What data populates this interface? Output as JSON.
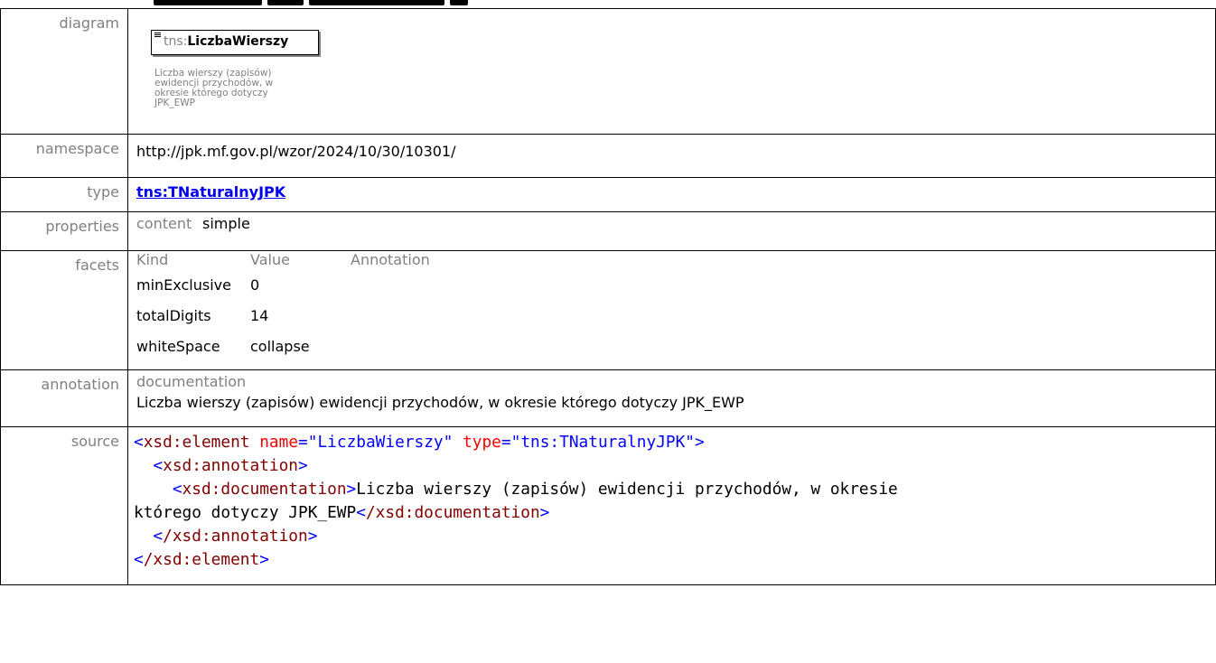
{
  "labels": {
    "diagram": "diagram",
    "namespace": "namespace",
    "type": "type",
    "properties": "properties",
    "facets": "facets",
    "annotation": "annotation",
    "source": "source"
  },
  "diagram": {
    "element_prefix": "tns:",
    "element_name": "LiczbaWierszy",
    "doc_lines": [
      "Liczba wierszy (zapisów)",
      "ewidencji przychodów, w",
      "okresie którego dotyczy",
      "JPK_EWP"
    ]
  },
  "namespace": "http://jpk.mf.gov.pl/wzor/2024/10/30/10301/",
  "type": "tns:TNaturalnyJPK",
  "properties": {
    "key": "content",
    "value": "simple"
  },
  "facets": {
    "headers": [
      "Kind",
      "Value",
      "Annotation"
    ],
    "rows": [
      {
        "kind": "minExclusive",
        "value": "0",
        "annotation": ""
      },
      {
        "kind": "totalDigits",
        "value": "14",
        "annotation": ""
      },
      {
        "kind": "whiteSpace",
        "value": "collapse",
        "annotation": ""
      }
    ]
  },
  "annotation": {
    "key": "documentation",
    "text": "Liczba wierszy (zapisów) ewidencji przychodów, w okresie którego dotyczy JPK_EWP"
  },
  "source": {
    "el_open": "xsd:element",
    "attr_name": "name",
    "attr_name_val": "\"LiczbaWierszy\"",
    "attr_type": "type",
    "attr_type_val": "\"tns:TNaturalnyJPK\"",
    "annotation_tag": "xsd:annotation",
    "documentation_tag": "xsd:documentation",
    "doc_text_1": "Liczba wierszy (zapisów) ewidencji przychodów, w okresie",
    "doc_text_2": "którego dotyczy JPK_EWP",
    "annotation_close": "/xsd:annotation",
    "documentation_close": "/xsd:documentation",
    "el_close": "/xsd:element"
  }
}
